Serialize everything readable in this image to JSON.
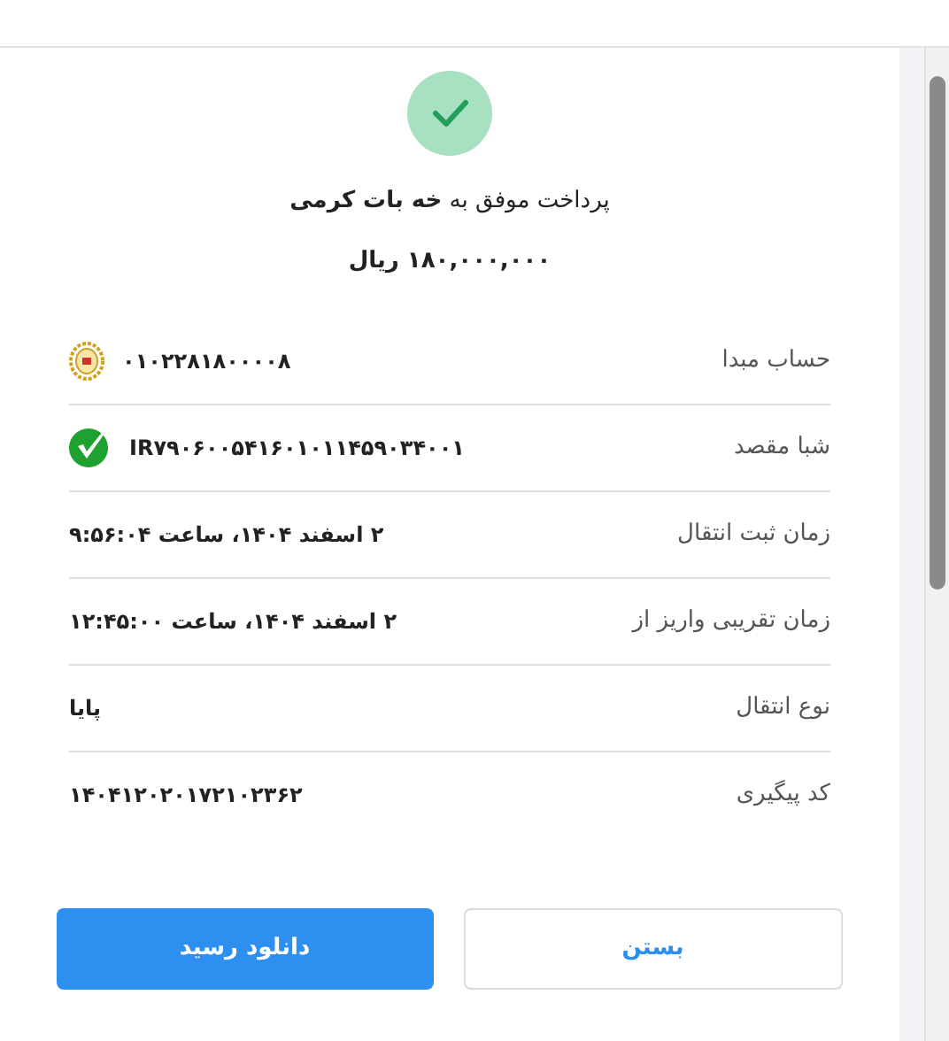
{
  "header": {
    "title": "پرداخت موفق به **خه بات کرمی**",
    "amount": "۱۸۰,۰۰۰,۰۰۰ ریال"
  },
  "details": [
    {
      "label": "حساب مبدا",
      "value": "۰۱۰۲۲۸۱۸۰۰۰۰۸",
      "kind": "bank"
    },
    {
      "label": "شبا مقصد",
      "value": "IR۷۹۰۶۰۰۵۴۱۶۰۱۰۱۱۴۵۹۰۳۴۰۰۱",
      "kind": "verified"
    },
    {
      "label": "زمان ثبت انتقال",
      "value": "۲ اسفند ۱۴۰۴، ساعت ۹:۵۶:۰۴",
      "kind": "plain"
    },
    {
      "label": "زمان تقریبی واریز از",
      "value": "۲ اسفند ۱۴۰۴، ساعت ۱۲:۴۵:۰۰",
      "kind": "plain"
    },
    {
      "label": "نوع انتقال",
      "value": "پایا",
      "kind": "plain"
    },
    {
      "label": "کد پیگیری",
      "value": "۱۴۰۴۱۲۰۲۰۱۷۲۱۰۲۳۶۲",
      "kind": "plain"
    }
  ],
  "buttons": {
    "close": "بستن",
    "download": "دانلود رسید"
  }
}
